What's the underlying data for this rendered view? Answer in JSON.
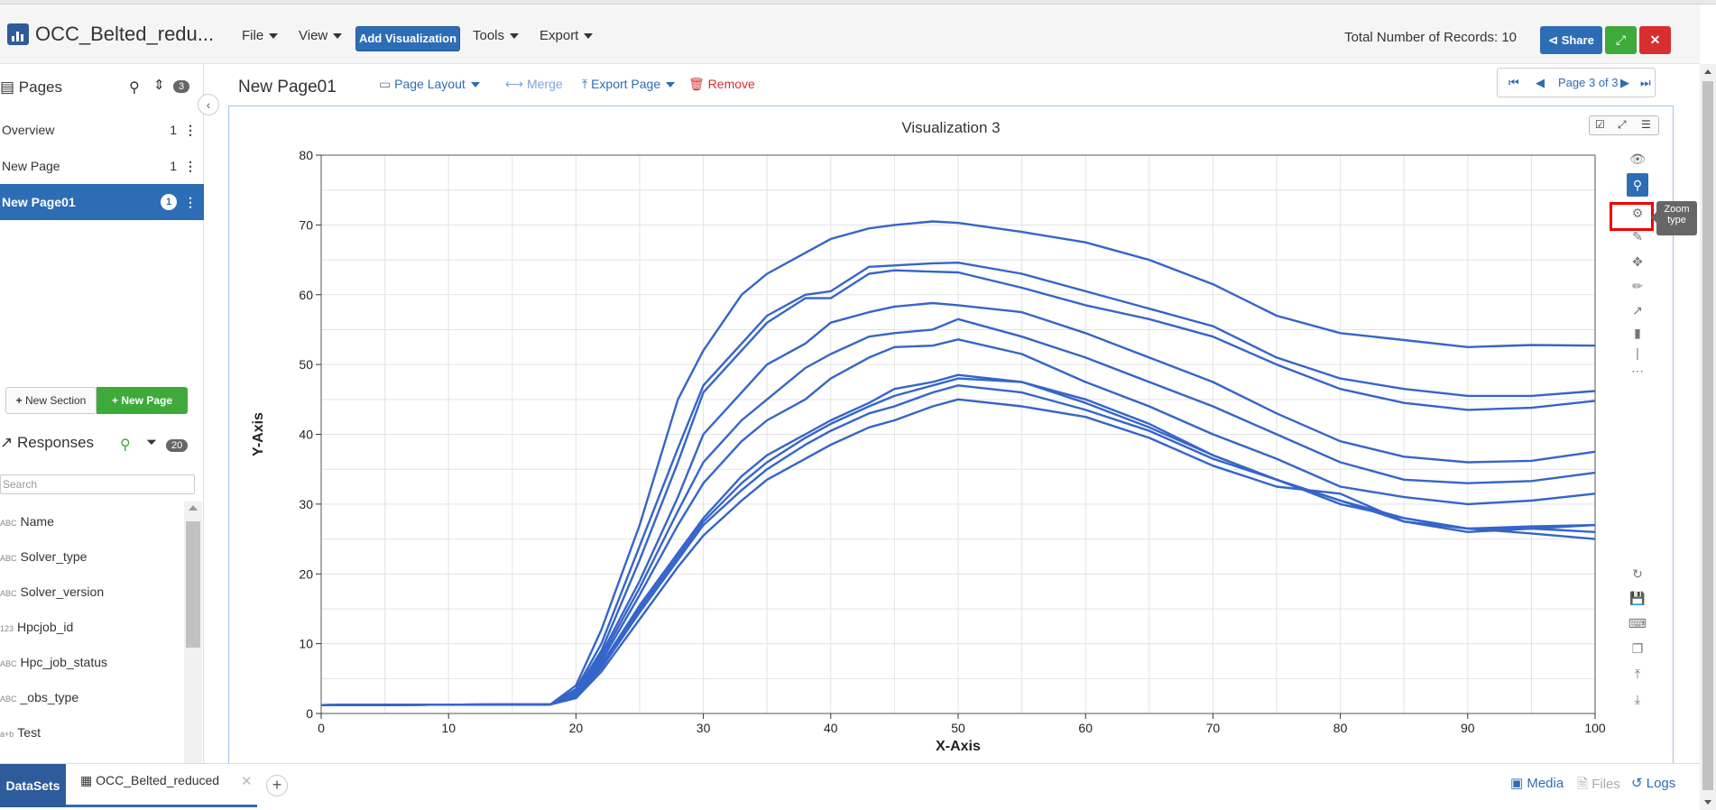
{
  "app": {
    "title": "OCC_Belted_redu..."
  },
  "menu": {
    "file": "File",
    "view": "View",
    "add_visualization": "Add Visualization",
    "tools": "Tools",
    "export": "Export"
  },
  "header": {
    "records": "Total Number of Records: 10",
    "share": "Share"
  },
  "sidebar": {
    "pages_title": "Pages",
    "pages_count": "3",
    "pages": [
      {
        "label": "Overview",
        "count": "1"
      },
      {
        "label": "New Page",
        "count": "1"
      },
      {
        "label": "New Page01",
        "count": "1"
      }
    ],
    "new_section": "New Section",
    "new_page": "New Page",
    "responses_title": "Responses",
    "responses_count": "20",
    "search_placeholder": "Search",
    "fields": [
      {
        "type": "ABC",
        "name": "Name"
      },
      {
        "type": "ABC",
        "name": "Solver_type"
      },
      {
        "type": "ABC",
        "name": "Solver_version"
      },
      {
        "type": "123",
        "name": "Hpcjob_id"
      },
      {
        "type": "ABC",
        "name": "Hpc_job_status"
      },
      {
        "type": "ABC",
        "name": "_obs_type"
      },
      {
        "type": "a+b",
        "name": "Test"
      }
    ]
  },
  "page": {
    "title": "New Page01",
    "page_layout": "Page Layout",
    "merge": "Merge",
    "export_page": "Export Page",
    "remove": "Remove",
    "pager": "Page 3 of 3"
  },
  "viz": {
    "title": "Visualization 3",
    "tooltip": "Zoom type"
  },
  "chart_data": {
    "type": "line",
    "xlabel": "X-Axis",
    "ylabel": "Y-Axis",
    "xlim": [
      0,
      100
    ],
    "ylim": [
      0,
      80
    ],
    "xticks": [
      0,
      10,
      20,
      30,
      40,
      50,
      60,
      70,
      80,
      90,
      100
    ],
    "yticks": [
      0,
      10,
      20,
      30,
      40,
      50,
      60,
      70,
      80
    ],
    "grid": true,
    "line_color": "#3565c9",
    "x": [
      0,
      18,
      20,
      22,
      25,
      28,
      30,
      33,
      35,
      38,
      40,
      43,
      45,
      48,
      50,
      55,
      60,
      65,
      70,
      75,
      80,
      85,
      90,
      95,
      100
    ],
    "series": [
      {
        "values": [
          1.2,
          1.3,
          4,
          12,
          27,
          45,
          52,
          60,
          63,
          66,
          68,
          69.5,
          70,
          70.5,
          70.3,
          69,
          67.5,
          65,
          61.5,
          57,
          54.5,
          53.5,
          52.5,
          52.8,
          52.7
        ]
      },
      {
        "values": [
          1.2,
          1.3,
          3.5,
          10,
          24,
          38,
          47,
          53,
          57,
          60,
          60.5,
          64,
          64.2,
          64.5,
          64.6,
          63,
          60.5,
          58,
          55.5,
          51,
          48,
          46.5,
          45.5,
          45.5,
          46.2
        ]
      },
      {
        "values": [
          1.2,
          1.3,
          3.2,
          9,
          22,
          36,
          46,
          52,
          56,
          59.5,
          59.5,
          63,
          63.5,
          63.3,
          63.2,
          61,
          58.5,
          56.5,
          54,
          50,
          46.5,
          44.5,
          43.5,
          43.8,
          44.8
        ]
      },
      {
        "values": [
          1.2,
          1.3,
          3,
          8.5,
          19,
          31,
          40,
          46,
          50,
          53,
          56,
          57.5,
          58.3,
          58.8,
          58.5,
          57.5,
          54.5,
          51,
          47.5,
          43,
          39,
          36.8,
          36,
          36.2,
          37.5
        ]
      },
      {
        "values": [
          1.2,
          1.3,
          2.8,
          8,
          18,
          29,
          36,
          42,
          45,
          49.5,
          51.5,
          54,
          54.5,
          55,
          56.5,
          54,
          51,
          47.5,
          44,
          40,
          36,
          33.5,
          33,
          33.3,
          34.5
        ]
      },
      {
        "values": [
          1.2,
          1.3,
          2.6,
          7.5,
          17,
          27,
          33,
          39,
          42,
          45,
          48,
          51,
          52.5,
          52.7,
          53.6,
          51.5,
          47.5,
          44,
          40,
          36.5,
          32.5,
          31,
          30,
          30.5,
          31.5
        ]
      },
      {
        "values": [
          1.2,
          1.3,
          2.5,
          7,
          15.5,
          23,
          28,
          34,
          37,
          40,
          42,
          44.5,
          46.5,
          47.5,
          48.5,
          47.5,
          44.5,
          41,
          37,
          33.5,
          30.5,
          28,
          26.5,
          26.8,
          27
        ]
      },
      {
        "values": [
          1.2,
          1.3,
          2.4,
          6.8,
          15,
          22.5,
          27.5,
          33,
          36,
          39.5,
          41.5,
          44,
          45.5,
          47,
          48,
          47.5,
          45,
          41.5,
          37,
          33.5,
          30,
          28,
          26.5,
          26.5,
          26
        ]
      },
      {
        "values": [
          1.2,
          1.3,
          2.3,
          6.5,
          14.5,
          22,
          27,
          32,
          35,
          38.5,
          40.5,
          43,
          44,
          46,
          47,
          46,
          43.5,
          40.5,
          36.5,
          33.5,
          30.5,
          27.5,
          26.5,
          25.8,
          25
        ]
      },
      {
        "values": [
          1.2,
          1.3,
          2.2,
          6,
          13.5,
          21,
          25.5,
          30.5,
          33.5,
          36.5,
          38.5,
          41,
          42,
          44,
          45,
          44,
          42.5,
          39.5,
          35.5,
          32.5,
          31.5,
          27.5,
          26,
          26.5,
          27
        ]
      }
    ]
  },
  "bottom": {
    "datasets": "DataSets",
    "file": "OCC_Belted_reduced",
    "media": "Media",
    "files": "Files",
    "logs": "Logs"
  }
}
